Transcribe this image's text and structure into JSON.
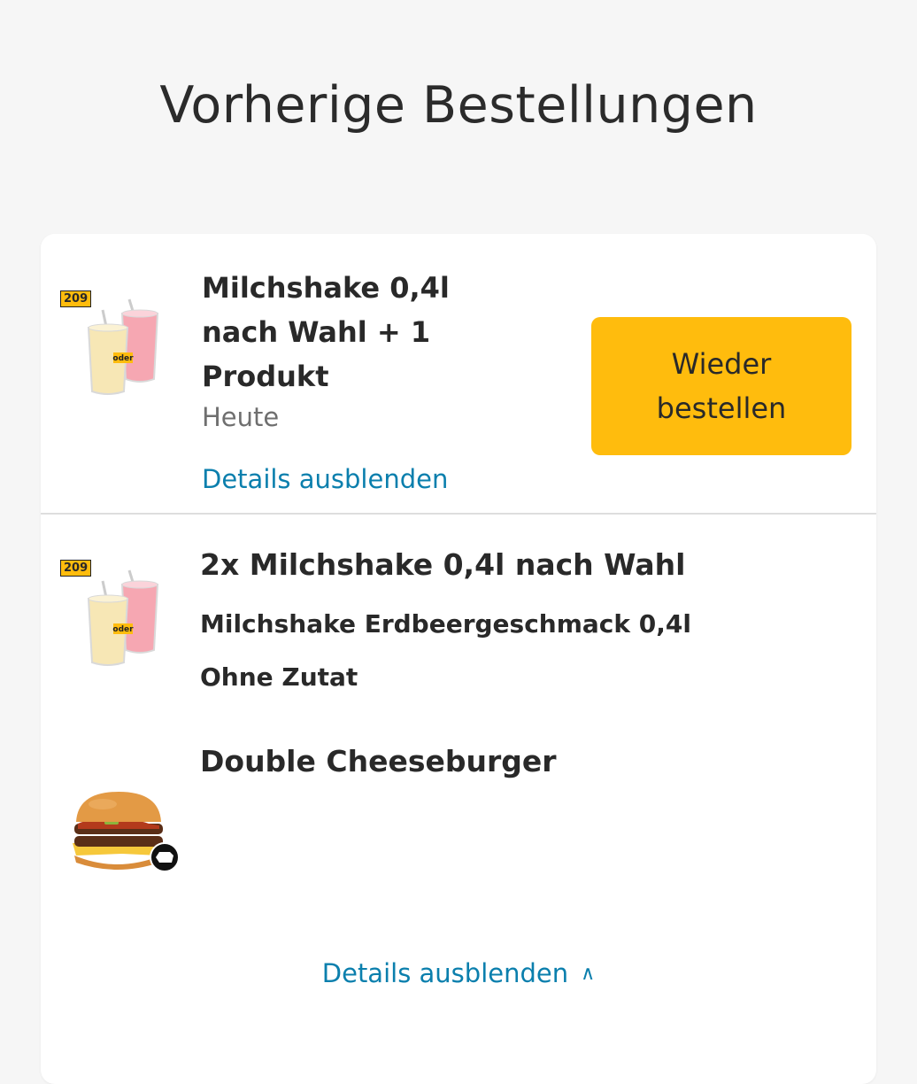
{
  "page": {
    "title": "Vorherige Bestellungen"
  },
  "order": {
    "title": "Milchshake 0,4l nach Wahl + 1 Produkt",
    "date": "Heute",
    "reorder_label": "Wieder bestellen",
    "details_toggle": "Details ausblenden",
    "thumb_badge": "209",
    "thumb_oder": "oder"
  },
  "details": {
    "items": [
      {
        "title": "2x Milchshake 0,4l nach Wahl",
        "badge": "209",
        "oder": "oder",
        "options": [
          "Milchshake Erdbeergeschmack 0,4l",
          "Ohne Zutat"
        ]
      },
      {
        "title": "Double Cheeseburger",
        "options": []
      }
    ],
    "toggle_label": "Details ausblenden",
    "toggle_icon": "chevron-up-icon"
  },
  "colors": {
    "accent": "#ffbc0d",
    "link": "#0b7fad",
    "text": "#292929",
    "muted": "#6f6f6f",
    "background": "#f6f6f6"
  }
}
